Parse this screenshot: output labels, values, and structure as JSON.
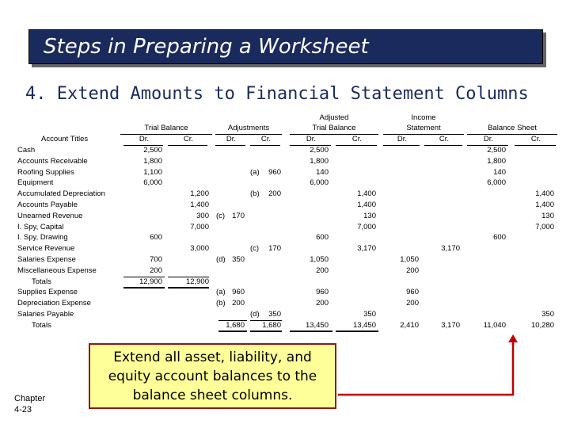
{
  "title": "Steps in Preparing a Worksheet",
  "subtitle": "4. Extend Amounts to Financial Statement Columns",
  "headers": {
    "account_titles": "Account Titles",
    "trial_balance": "Trial Balance",
    "adjustments": "Adjustments",
    "adjusted_1": "Adjusted",
    "adjusted_2": "Trial Balance",
    "income_1": "Income",
    "income_2": "Statement",
    "balance_sheet": "Balance Sheet",
    "dr": "Dr.",
    "cr": "Cr."
  },
  "rows": [
    [
      "Cash",
      "2,500",
      "",
      "",
      "",
      "",
      "",
      "2,500",
      "",
      "",
      "",
      "2,500",
      ""
    ],
    [
      "Accounts Receivable",
      "1,800",
      "",
      "",
      "",
      "",
      "",
      "1,800",
      "",
      "",
      "",
      "1,800",
      ""
    ],
    [
      "Roofing Supplies",
      "1,100",
      "",
      "",
      "",
      "(a)",
      "960",
      "140",
      "",
      "",
      "",
      "140",
      ""
    ],
    [
      "Equipment",
      "6,000",
      "",
      "",
      "",
      "",
      "",
      "6,000",
      "",
      "",
      "",
      "6,000",
      ""
    ],
    [
      "Accumulated Depreciation",
      "",
      "1,200",
      "",
      "",
      "(b)",
      "200",
      "",
      "1,400",
      "",
      "",
      "",
      "1,400"
    ],
    [
      "Accounts Payable",
      "",
      "1,400",
      "",
      "",
      "",
      "",
      "",
      "1,400",
      "",
      "",
      "",
      "1,400"
    ],
    [
      "Unearned Revenue",
      "",
      "300",
      "(c)",
      "170",
      "",
      "",
      "",
      "130",
      "",
      "",
      "",
      "130"
    ],
    [
      "I. Spy, Capital",
      "",
      "7,000",
      "",
      "",
      "",
      "",
      "",
      "7,000",
      "",
      "",
      "",
      "7,000"
    ],
    [
      "I. Spy, Drawing",
      "600",
      "",
      "",
      "",
      "",
      "",
      "600",
      "",
      "",
      "",
      "600",
      ""
    ],
    [
      "Service Revenue",
      "",
      "3,000",
      "",
      "",
      "(c)",
      "170",
      "",
      "3,170",
      "",
      "3,170",
      "",
      ""
    ],
    [
      "Salaries Expense",
      "700",
      "",
      "(d)",
      "350",
      "",
      "",
      "1,050",
      "",
      "1,050",
      "",
      "",
      ""
    ],
    [
      "Miscellaneous Expense",
      "200",
      "",
      "",
      "",
      "",
      "",
      "200",
      "",
      "200",
      "",
      "",
      ""
    ],
    [
      "   Totals",
      "12,900",
      "12,900",
      "",
      "",
      "",
      "",
      "",
      "",
      "",
      "",
      "",
      ""
    ],
    [
      "Supplies Expense",
      "",
      "",
      "(a)",
      "960",
      "",
      "",
      "960",
      "",
      "960",
      "",
      "",
      ""
    ],
    [
      "Depreciation Expense",
      "",
      "",
      "(b)",
      "200",
      "",
      "",
      "200",
      "",
      "200",
      "",
      "",
      ""
    ],
    [
      "Salaries Payable",
      "",
      "",
      "",
      "",
      "(d)",
      "350",
      "",
      "350",
      "",
      "",
      "",
      "350"
    ],
    [
      "   Totals",
      "",
      "",
      "",
      "1,680",
      "",
      "1,680",
      "13,450",
      "13,450",
      "2,410",
      "3,170",
      "11,040",
      "10,280"
    ]
  ],
  "callout": "Extend all asset, liability, and equity account balances to the balance sheet columns.",
  "chapter": "Chapter",
  "page": "4-23",
  "colors": {
    "title_bg": "#1a2a5c",
    "callout_bg": "#ffff99",
    "callout_border": "#8b1a1a",
    "arrow": "#c00000"
  }
}
